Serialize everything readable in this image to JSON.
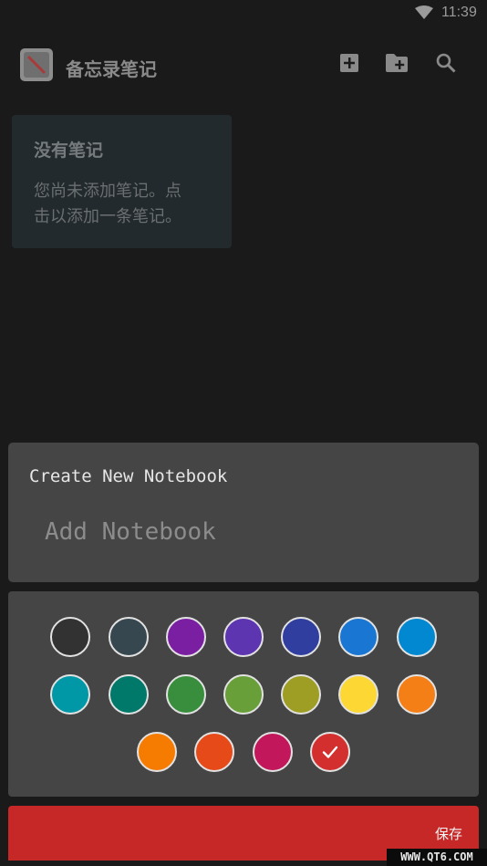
{
  "status_bar": {
    "time": "11:39",
    "wifi_icon": "wifi-icon"
  },
  "app_bar": {
    "title": "备忘录笔记",
    "actions": [
      {
        "name": "add-note",
        "icon": "plus-box-icon"
      },
      {
        "name": "add-folder",
        "icon": "folder-plus-icon"
      },
      {
        "name": "search",
        "icon": "search-icon"
      }
    ]
  },
  "empty_state": {
    "title": "没有笔记",
    "line1": "您尚未添加笔记。点",
    "line2": "击以添加一条笔记。"
  },
  "dialog": {
    "title": "Create New Notebook",
    "input_placeholder": "Add Notebook",
    "input_value": ""
  },
  "palette": {
    "rows": [
      [
        "#323232",
        "#37474f",
        "#7b1fa2",
        "#5e35b1",
        "#303f9f",
        "#1976d2",
        "#0288d1"
      ],
      [
        "#0097a7",
        "#00796b",
        "#388e3c",
        "#689f38",
        "#9e9d24",
        "#fdd835",
        "#f57f17"
      ],
      [
        "#f57c00",
        "#e64a19",
        "#c2185b",
        "#d32f2f"
      ]
    ],
    "selected": "#d32f2f"
  },
  "save_button": {
    "label": "保存",
    "color": "#c62828"
  },
  "watermark": "WWW.QT6.COM"
}
